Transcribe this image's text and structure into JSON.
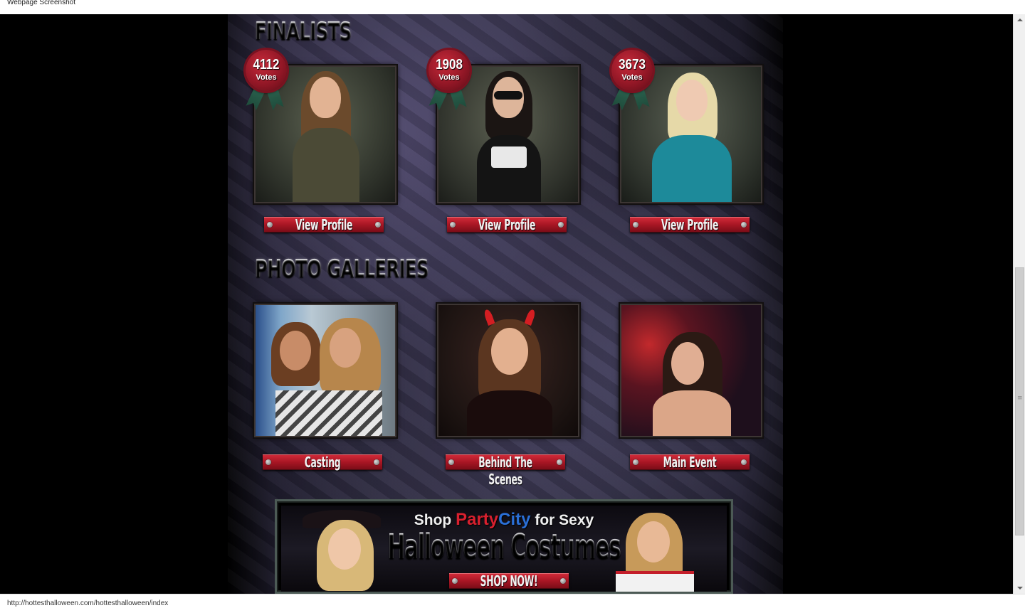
{
  "window": {
    "title": "Webpage Screenshot"
  },
  "finalists": {
    "heading": "FINALISTS",
    "items": [
      {
        "votes": "4112",
        "votes_label": "Votes",
        "button": "View Profile"
      },
      {
        "votes": "1908",
        "votes_label": "Votes",
        "button": "View Profile"
      },
      {
        "votes": "3673",
        "votes_label": "Votes",
        "button": "View Profile"
      }
    ]
  },
  "galleries": {
    "heading": "PHOTO GALLERIES",
    "items": [
      {
        "button": "Casting"
      },
      {
        "button": "Behind The Scenes"
      },
      {
        "button": "Main Event"
      }
    ]
  },
  "banner": {
    "shop": "Shop",
    "brand_party": "Party",
    "brand_city": "City",
    "for_sexy": "for Sexy",
    "title": "Halloween Costumes",
    "cta": "SHOP NOW!"
  },
  "status_bar": {
    "url": "http://hottesthalloween.com/hottesthalloween/index"
  },
  "colors": {
    "accent_red": "#a81624",
    "ribbon_green": "#2f6a55",
    "background": "#000000"
  }
}
